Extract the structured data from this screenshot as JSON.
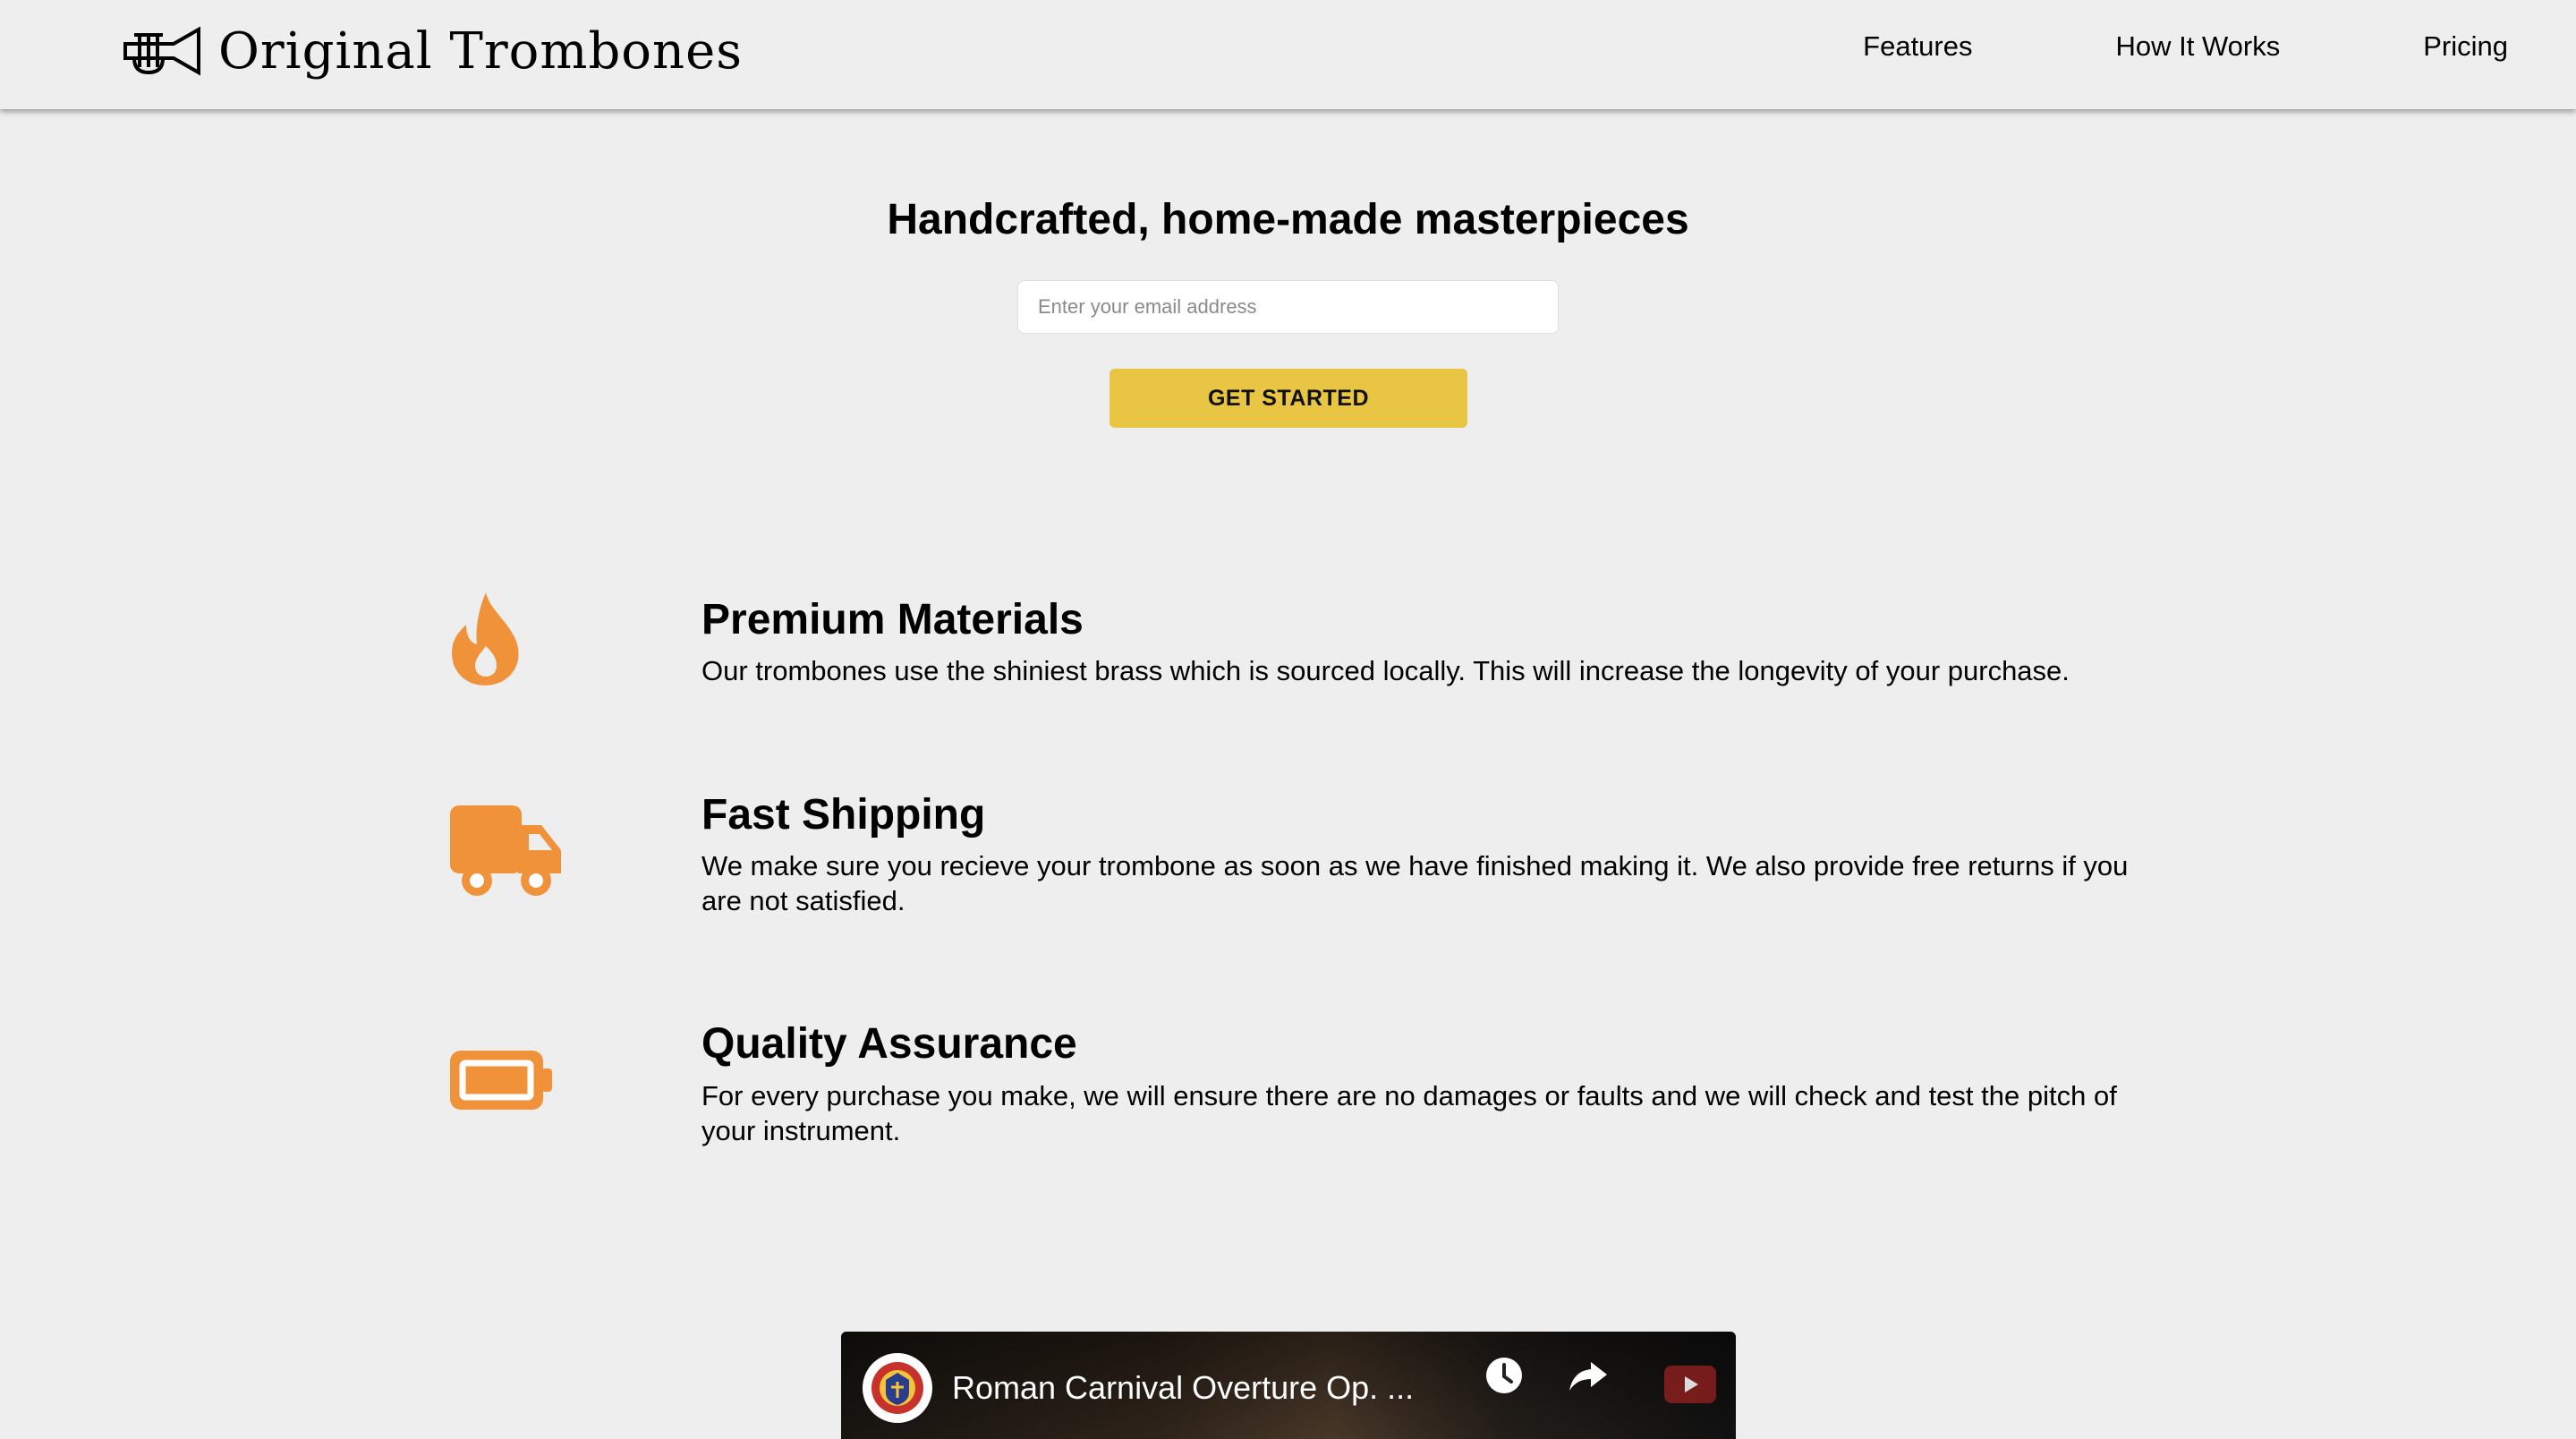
{
  "header": {
    "logo_text": "Original Trombones",
    "nav": [
      {
        "label": "Features"
      },
      {
        "label": "How It Works"
      },
      {
        "label": "Pricing"
      }
    ]
  },
  "hero": {
    "title": "Handcrafted, home-made masterpieces",
    "email_placeholder": "Enter your email address",
    "email_value": "",
    "cta_label": "GET STARTED"
  },
  "features": [
    {
      "icon": "fire-icon",
      "title": "Premium Materials",
      "description": "Our trombones use the shiniest brass which is sourced locally. This will increase the longevity of your purchase."
    },
    {
      "icon": "truck-icon",
      "title": "Fast Shipping",
      "description": "We make sure you recieve your trombone as soon as we have finished making it. We also provide free returns if you are not satisfied."
    },
    {
      "icon": "battery-icon",
      "title": "Quality Assurance",
      "description": "For every purchase you make, we will ensure there are no damages or faults and we will check and test the pitch of your instrument."
    }
  ],
  "video": {
    "title": "Roman Carnival Overture Op. ..."
  },
  "colors": {
    "background": "#eeeeee",
    "accent_button": "#e8c542",
    "icon_orange": "#f0923a"
  }
}
